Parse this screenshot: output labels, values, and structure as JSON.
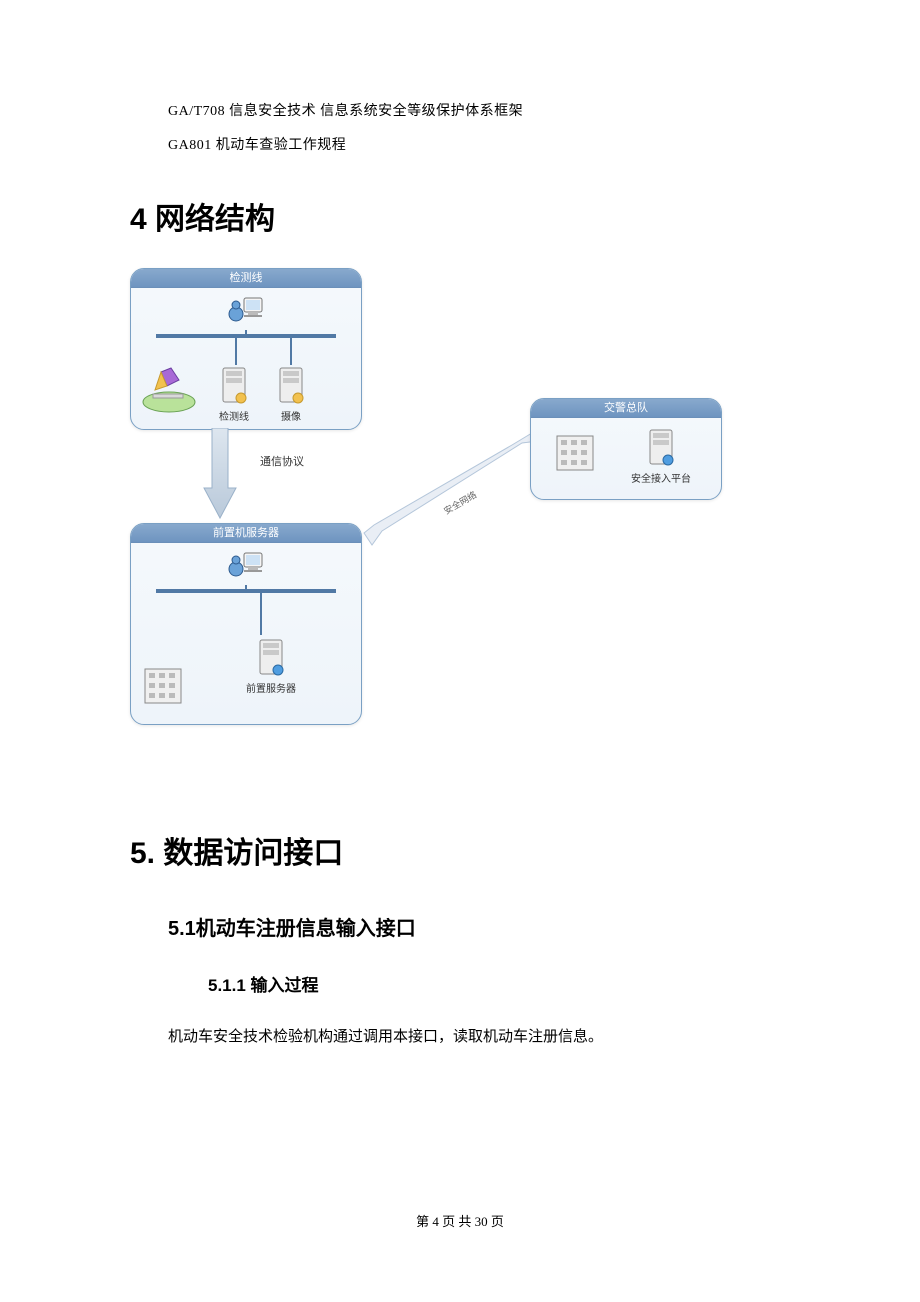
{
  "refs": [
    "GA/T708 信息安全技术 信息系统安全等级保护体系框架",
    "GA801 机动车查验工作规程"
  ],
  "section4": "4 网络结构",
  "diagram": {
    "panel1": {
      "title": "检测线",
      "node_detect": "检测线",
      "node_camera": "摄像"
    },
    "panel2": {
      "title": "前置机服务器",
      "node_front": "前置服务器"
    },
    "panel3": {
      "title": "交警总队",
      "node_platform": "安全接入平台"
    },
    "edge_protocol": "通信协议",
    "edge_network": "安全网络"
  },
  "section5": "5. 数据访问接口",
  "section5_1": "5.1机动车注册信息输入接口",
  "section5_1_1": "5.1.1  输入过程",
  "body5_1_1": "机动车安全技术检验机构通过调用本接口，读取机动车注册信息。",
  "footer": "第 4 页 共 30 页"
}
